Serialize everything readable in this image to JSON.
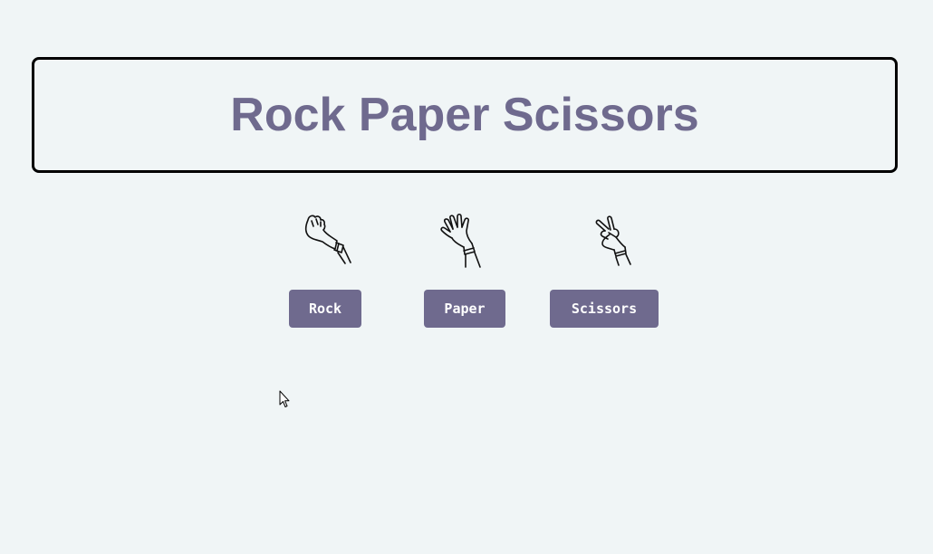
{
  "header": {
    "title": "Rock Paper Scissors"
  },
  "choices": [
    {
      "label": "Rock",
      "icon": "rock-hand-icon"
    },
    {
      "label": "Paper",
      "icon": "paper-hand-icon"
    },
    {
      "label": "Scissors",
      "icon": "scissors-hand-icon"
    }
  ],
  "colors": {
    "background": "#f0f5f6",
    "accent": "#6f6a8e",
    "border": "#000000",
    "button_text": "#ffffff"
  },
  "cursor": {
    "icon": "mouse-pointer-icon"
  }
}
